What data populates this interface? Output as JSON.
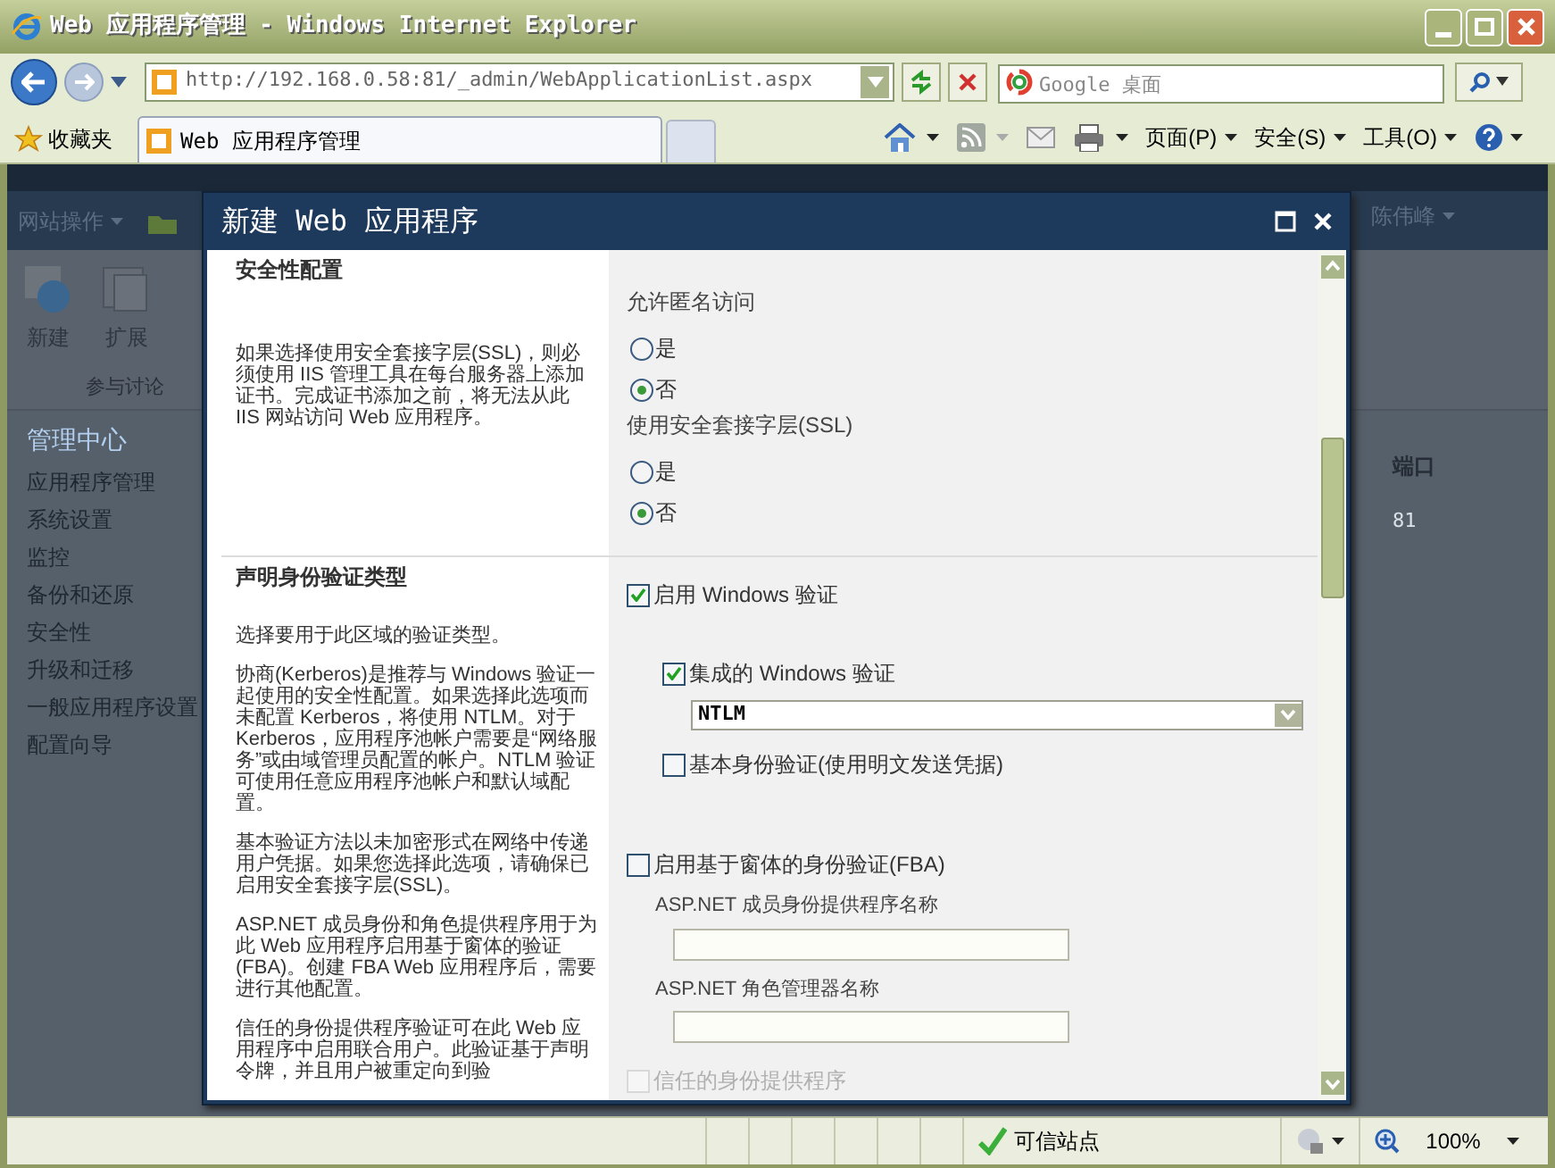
{
  "window": {
    "title": "Web 应用程序管理 - Windows Internet Explorer"
  },
  "address_bar": {
    "url": "http://192.168.0.58:81/_admin/WebApplicationList.aspx"
  },
  "search": {
    "placeholder": "Google 桌面"
  },
  "favorites": {
    "label": "收藏夹"
  },
  "tabs": [
    {
      "label": "Web 应用程序管理",
      "selected": true
    }
  ],
  "command_bar": [
    {
      "kind": "home"
    },
    {
      "kind": "feed"
    },
    {
      "kind": "mail"
    },
    {
      "kind": "print"
    },
    {
      "kind": "menu",
      "label": "页面(P)"
    },
    {
      "kind": "menu",
      "label": "安全(S)"
    },
    {
      "kind": "menu",
      "label": "工具(O)"
    },
    {
      "kind": "help"
    }
  ],
  "site": {
    "site_actions": "网站操作",
    "user": "陈伟峰",
    "ribbon": [
      {
        "label": "新建"
      },
      {
        "label": "扩展"
      }
    ],
    "ribbon_group": "参与讨论",
    "nav": [
      {
        "label": "管理中心",
        "selected": true
      },
      {
        "label": "应用程序管理",
        "selected": false
      },
      {
        "label": "系统设置",
        "selected": false
      },
      {
        "label": "监控",
        "selected": false
      },
      {
        "label": "备份和还原",
        "selected": false
      },
      {
        "label": "安全性",
        "selected": false
      },
      {
        "label": "升级和迁移",
        "selected": false
      },
      {
        "label": "一般应用程序设置",
        "selected": false
      },
      {
        "label": "配置向导",
        "selected": false
      }
    ],
    "table": {
      "columns": [
        "端口"
      ],
      "rows": [
        [
          "81"
        ]
      ]
    }
  },
  "dialog": {
    "title": "新建 Web 应用程序",
    "sections": [
      {
        "heading": "安全性配置",
        "paragraphs": [
          "如果选择使用安全套接字层(SSL)，则必须使用 IIS 管理工具在每台服务器上添加证书。完成证书添加之前，将无法从此 IIS 网站访问 Web 应用程序。"
        ],
        "fields": [
          {
            "kind": "radio",
            "label": "允许匿名访问",
            "options": [
              {
                "label": "是",
                "selected": false
              },
              {
                "label": "否",
                "selected": true
              }
            ]
          },
          {
            "kind": "radio",
            "label": "使用安全套接字层(SSL)",
            "options": [
              {
                "label": "是",
                "selected": false
              },
              {
                "label": "否",
                "selected": true
              }
            ]
          }
        ]
      },
      {
        "heading": "声明身份验证类型",
        "paragraphs": [
          "选择要用于此区域的验证类型。",
          "协商(Kerberos)是推荐与 Windows 验证一起使用的安全性配置。如果选择此选项而未配置 Kerberos，将使用 NTLM。对于 Kerberos，应用程序池帐户需要是“网络服务”或由域管理员配置的帐户。NTLM 验证可使用任意应用程序池帐户和默认域配置。",
          "基本验证方法以未加密形式在网络中传递用户凭据。如果您选择此选项，请确保已启用安全套接字层(SSL)。",
          "ASP.NET 成员身份和角色提供程序用于为此 Web 应用程序启用基于窗体的验证(FBA)。创建 FBA Web 应用程序后，需要进行其他配置。",
          "信任的身份提供程序验证可在此 Web 应用程序中启用联合用户。此验证基于声明令牌，并且用户被重定向到验"
        ],
        "fields": [
          {
            "kind": "checkbox",
            "label": "启用 Windows 验证",
            "checked": true,
            "disabled": false,
            "children": [
              {
                "kind": "checkbox",
                "label": "集成的 Windows 验证",
                "checked": true,
                "disabled": false
              },
              {
                "kind": "select",
                "value": "NTLM"
              },
              {
                "kind": "checkbox",
                "label": "基本身份验证(使用明文发送凭据)",
                "checked": false,
                "disabled": false
              }
            ]
          },
          {
            "kind": "checkbox",
            "label": "启用基于窗体的身份验证(FBA)",
            "checked": false,
            "disabled": false
          },
          {
            "kind": "text",
            "label": "ASP.NET 成员身份提供程序名称"
          },
          {
            "kind": "text",
            "label": "ASP.NET 角色管理器名称"
          },
          {
            "kind": "checkbox",
            "label": "信任的身份提供程序",
            "checked": false,
            "disabled": true
          }
        ]
      }
    ]
  },
  "status_bar": {
    "zone": "可信站点",
    "zoom": "100%"
  }
}
